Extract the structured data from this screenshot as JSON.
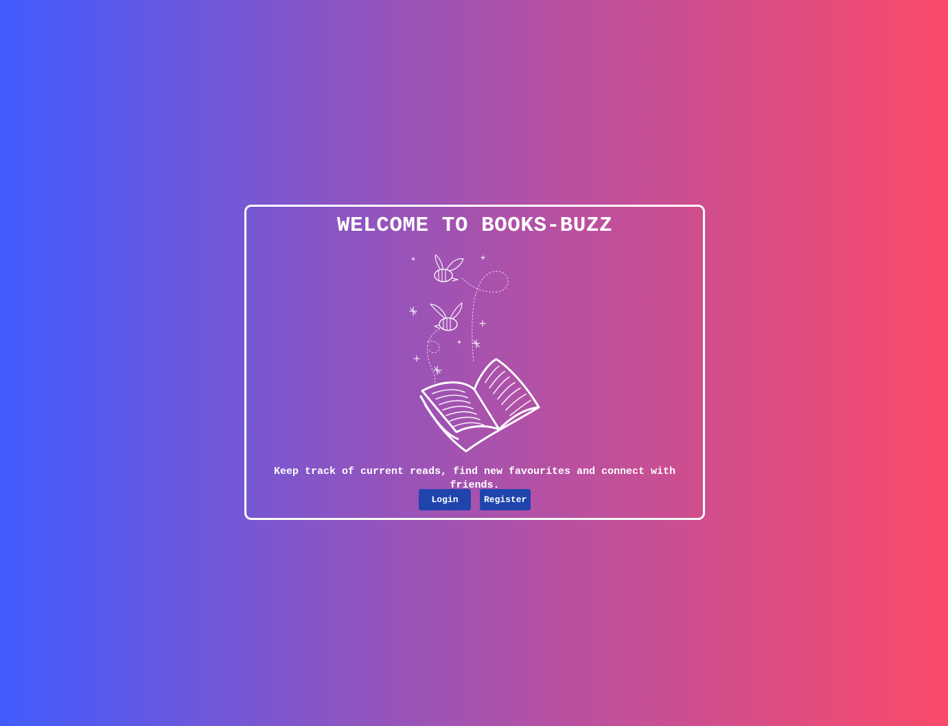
{
  "welcome": {
    "title": "WELCOME TO BOOKS-BUZZ",
    "tagline": "Keep track of current reads, find new favourites and connect with friends."
  },
  "illustration": {
    "icon": "book-with-bees-icon"
  },
  "actions": {
    "login_label": "Login",
    "register_label": "Register"
  },
  "colors": {
    "gradient_left": "#405cff",
    "gradient_right": "#fa4a6a",
    "button_bg": "#1f45ad",
    "text": "#ffffff"
  }
}
